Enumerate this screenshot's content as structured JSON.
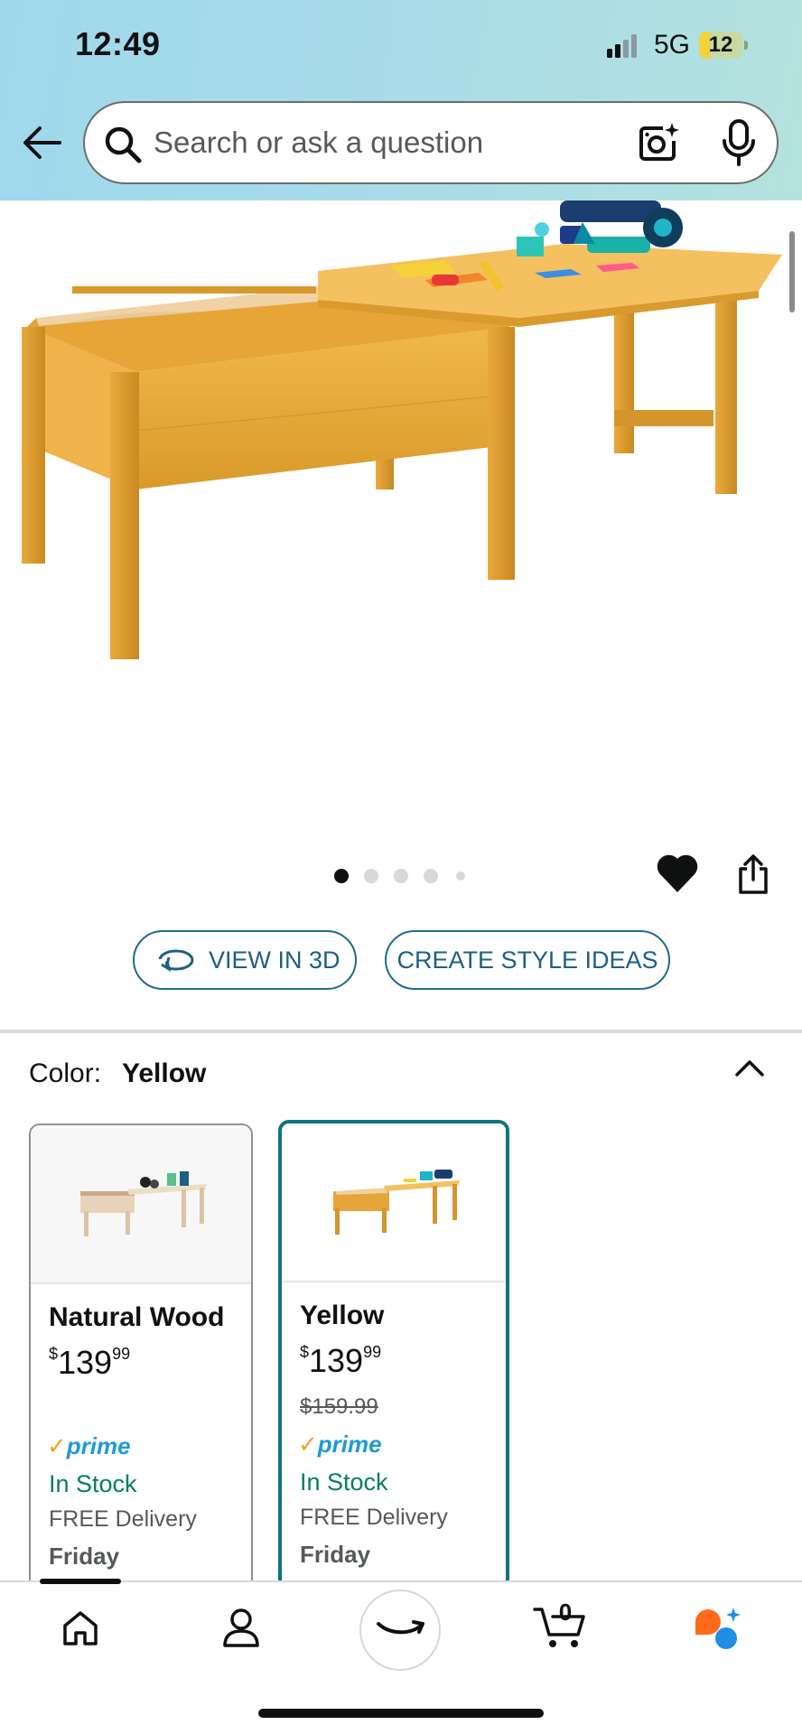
{
  "status_bar": {
    "time": "12:49",
    "network": "5G",
    "battery": "12",
    "battery_level_percent": 12
  },
  "search": {
    "placeholder": "Search or ask a question",
    "icons": [
      "back-arrow-icon",
      "search-icon",
      "camera-lens-icon",
      "microphone-icon"
    ]
  },
  "gallery": {
    "image_count": 5,
    "current_index": 0,
    "actions": [
      "heart-icon",
      "share-icon"
    ]
  },
  "actions": {
    "view_3d": "VIEW IN 3D",
    "style_ideas": "CREATE STYLE IDEAS"
  },
  "color": {
    "label": "Color:",
    "selected": "Yellow"
  },
  "swatches": [
    {
      "name": "Natural Wood",
      "price_symbol": "$",
      "price_whole": "139",
      "price_fraction": "99",
      "list_price": "",
      "prime": "prime",
      "stock": "In Stock",
      "delivery": "FREE Delivery",
      "day": "Friday",
      "selected": false
    },
    {
      "name": "Yellow",
      "price_symbol": "$",
      "price_whole": "139",
      "price_fraction": "99",
      "list_price": "$159.99",
      "prime": "prime",
      "stock": "In Stock",
      "delivery": "FREE Delivery",
      "day": "Friday",
      "selected": true
    }
  ],
  "bottom_nav": {
    "cart_count": "0",
    "items": [
      "home-icon",
      "account-icon",
      "amazon-smile-icon",
      "cart-icon",
      "rufus-icon"
    ]
  },
  "colors": {
    "header_gradient_start": "#9fd8ec",
    "header_gradient_end": "#b4e2de",
    "link_blue": "#1d5f86",
    "selected_teal": "#0e7383",
    "in_stock_green": "#067d62",
    "prime_blue": "#1f9ad6",
    "prime_check_orange": "#f4a024",
    "rufus_orange": "#ff6a1a",
    "rufus_blue": "#1e8ee6"
  }
}
